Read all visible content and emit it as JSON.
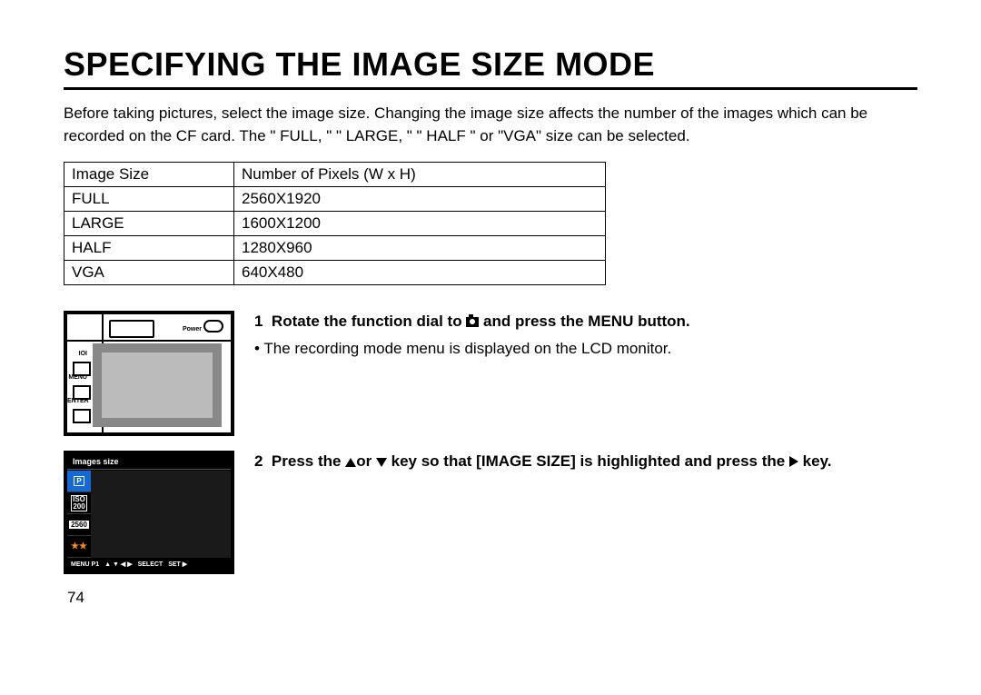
{
  "title": "SPECIFYING THE IMAGE SIZE MODE",
  "intro": "Before taking pictures, select the image size. Changing the image size affects the number of the images which can be recorded on the CF card. The \" FULL, \"  \" LARGE, \"  \" HALF \"  or  \"VGA\" size can be selected.",
  "table": {
    "headers": {
      "a": "Image Size",
      "b": "Number of Pixels (W x H)"
    },
    "rows": [
      {
        "a": "FULL",
        "b": "2560X1920"
      },
      {
        "a": "LARGE",
        "b": "1600X1200"
      },
      {
        "a": "HALF",
        "b": "1280X960"
      },
      {
        "a": "VGA",
        "b": "640X480"
      }
    ]
  },
  "step1": {
    "num": "1",
    "lead_a": "Rotate the function dial to ",
    "lead_b": " and press the MENU button.",
    "bullet": "• The recording mode menu is displayed  on the LCD monitor."
  },
  "step2": {
    "num": "2",
    "lead_a": "Press the ",
    "lead_mid1": "or ",
    "lead_mid2": " key so that [IMAGE SIZE] is highlighted and press the ",
    "lead_b": " key."
  },
  "fig1": {
    "power": "Power",
    "labels": [
      "IOI",
      "MENU",
      "ENTER"
    ]
  },
  "fig2": {
    "header": "Images size",
    "side": [
      "P",
      "ISO\n200",
      "2560",
      "★★"
    ],
    "footer": {
      "menu": "MENU P1",
      "nav": "▲ ▼ ◀ ▶",
      "select": "SELECT",
      "set": "SET ▶"
    }
  },
  "page_number": "74"
}
